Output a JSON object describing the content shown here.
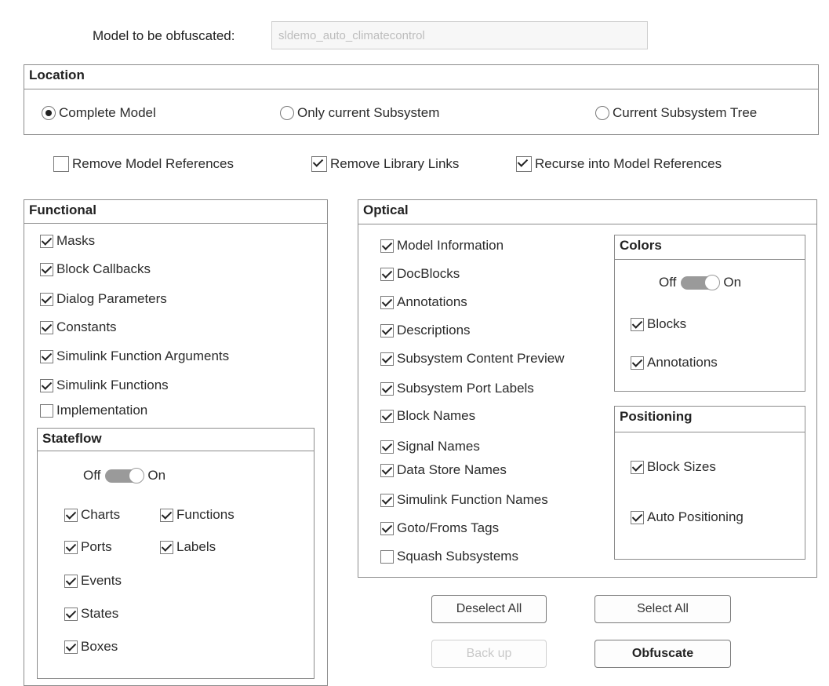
{
  "model": {
    "label": "Model to be obfuscated:",
    "value": "sldemo_auto_climatecontrol"
  },
  "location": {
    "title": "Location",
    "options": [
      "Complete Model",
      "Only current Subsystem",
      "Current Subsystem Tree"
    ],
    "selected": "Complete Model"
  },
  "refs": [
    {
      "label": "Remove Model References",
      "checked": false
    },
    {
      "label": "Remove Library Links",
      "checked": true
    },
    {
      "label": "Recurse into Model References",
      "checked": true
    }
  ],
  "functional": {
    "title": "Functional",
    "items": [
      {
        "label": "Masks",
        "checked": true
      },
      {
        "label": "Block Callbacks",
        "checked": true
      },
      {
        "label": "Dialog Parameters",
        "checked": true
      },
      {
        "label": "Constants",
        "checked": true
      },
      {
        "label": "Simulink Function Arguments",
        "checked": true
      },
      {
        "label": "Simulink Functions",
        "checked": true
      },
      {
        "label": "Implementation",
        "checked": false
      }
    ],
    "stateflow": {
      "title": "Stateflow",
      "toggle_off": "Off",
      "toggle_on": "On",
      "items": [
        {
          "label": "Charts",
          "checked": true
        },
        {
          "label": "Functions",
          "checked": true
        },
        {
          "label": "Ports",
          "checked": true
        },
        {
          "label": "Labels",
          "checked": true
        },
        {
          "label": "Events",
          "checked": true
        },
        {
          "label": "States",
          "checked": true
        },
        {
          "label": "Boxes",
          "checked": true
        }
      ]
    }
  },
  "optical": {
    "title": "Optical",
    "items": [
      {
        "label": "Model Information",
        "checked": true
      },
      {
        "label": "DocBlocks",
        "checked": true
      },
      {
        "label": "Annotations",
        "checked": true
      },
      {
        "label": "Descriptions",
        "checked": true
      },
      {
        "label": "Subsystem Content Preview",
        "checked": true
      },
      {
        "label": "Subsystem Port Labels",
        "checked": true
      },
      {
        "label": "Block Names",
        "checked": true
      },
      {
        "label": "Signal Names",
        "checked": true
      },
      {
        "label": "Data Store Names",
        "checked": true
      },
      {
        "label": "Simulink Function Names",
        "checked": true
      },
      {
        "label": "Goto/Froms Tags",
        "checked": true
      },
      {
        "label": "Squash Subsystems",
        "checked": false
      }
    ],
    "colors": {
      "title": "Colors",
      "toggle_off": "Off",
      "toggle_on": "On",
      "items": [
        {
          "label": "Blocks",
          "checked": true
        },
        {
          "label": "Annotations",
          "checked": true
        }
      ]
    },
    "positioning": {
      "title": "Positioning",
      "items": [
        {
          "label": "Block Sizes",
          "checked": true
        },
        {
          "label": "Auto Positioning",
          "checked": true
        }
      ]
    }
  },
  "buttons": {
    "deselect_all": "Deselect All",
    "select_all": "Select All",
    "back_up": "Back up",
    "obfuscate": "Obfuscate"
  }
}
